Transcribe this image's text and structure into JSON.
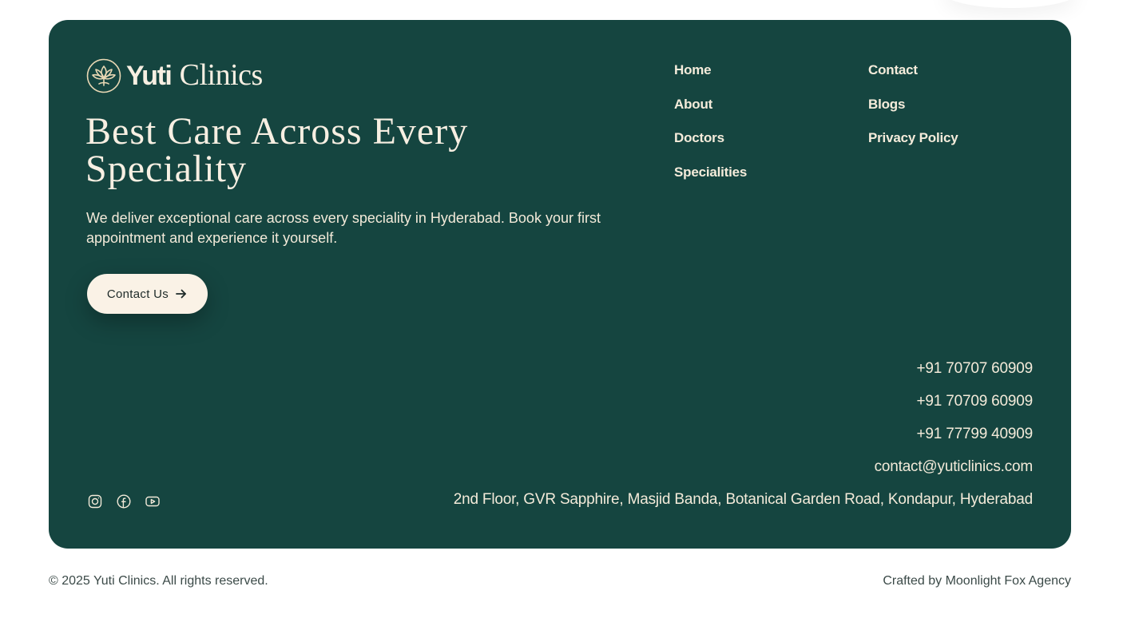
{
  "colors": {
    "card_background": "#154540",
    "cream": "#f7efe2",
    "button_background": "#faf2e6",
    "muted_text": "#3b4a48"
  },
  "brand": {
    "icon": "lotus-leaf-logo-icon",
    "name_strong": "Yuti",
    "name_light": "Clinics"
  },
  "hero": {
    "headline": "Best Care Across Every Speciality",
    "intro": "We deliver exceptional care across every speciality in Hyderabad. Book your first appointment and experience it yourself.",
    "cta_label": "Contact Us",
    "cta_icon": "arrow-right-icon"
  },
  "nav": {
    "column_1": [
      "Home",
      "About",
      "Doctors",
      "Specialities"
    ],
    "column_2": [
      "Contact",
      "Blogs",
      "Privacy Policy"
    ]
  },
  "contact": {
    "phones": [
      "+91 70707 60909",
      "+91 70709 60909",
      "+91 77799 40909"
    ],
    "email": "contact@yuticlinics.com",
    "address": "2nd Floor, GVR Sapphire, Masjid Banda, Botanical Garden Road, Kondapur, Hyderabad"
  },
  "social": [
    "instagram-icon",
    "facebook-icon",
    "youtube-icon"
  ],
  "bottom": {
    "copyright": "© 2025 Yuti Clinics. All rights reserved.",
    "credit": "Crafted by Moonlight Fox Agency"
  }
}
